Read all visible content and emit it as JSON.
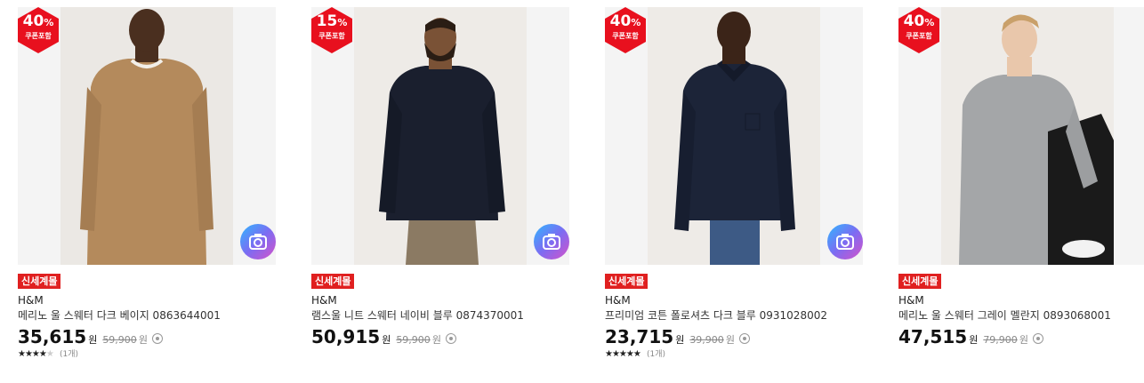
{
  "products": [
    {
      "discount_pct": "40",
      "discount_unit": "%",
      "discount_label": "쿠폰포함",
      "badge": "신세계몰",
      "brand": "H&M",
      "name": "메리노 울 스웨터 다크 베이지 0863644001",
      "price": "35,615",
      "currency": "원",
      "original_price": "59,900",
      "original_currency": "원",
      "rating": 4,
      "rating_stars": "★★★★",
      "rating_off_stars": "★",
      "review_count": "(1개)",
      "sweater_color": "#b48a5c"
    },
    {
      "discount_pct": "15",
      "discount_unit": "%",
      "discount_label": "쿠폰포함",
      "badge": "신세계몰",
      "brand": "H&M",
      "name": "램스울 니트 스웨터 네이비 블루 0874370001",
      "price": "50,915",
      "currency": "원",
      "original_price": "59,900",
      "original_currency": "원",
      "sweater_color": "#1a1f2e"
    },
    {
      "discount_pct": "40",
      "discount_unit": "%",
      "discount_label": "쿠폰포함",
      "badge": "신세계몰",
      "brand": "H&M",
      "name": "프리미엄 코튼 폴로셔츠 다크 블루 0931028002",
      "price": "23,715",
      "currency": "원",
      "original_price": "39,900",
      "original_currency": "원",
      "rating": 5,
      "rating_stars": "★★★★★",
      "review_count": "(1개)",
      "sweater_color": "#1c2438"
    },
    {
      "discount_pct": "40",
      "discount_unit": "%",
      "discount_label": "쿠폰포함",
      "badge": "신세계몰",
      "brand": "H&M",
      "name": "메리노 울 스웨터 그레이 멜란지 0893068001",
      "price": "47,515",
      "currency": "원",
      "original_price": "79,900",
      "original_currency": "원",
      "sweater_color": "#a4a6a8"
    }
  ],
  "colors": {
    "discount_badge": "#e8101e",
    "mall_badge": "#e02020"
  }
}
